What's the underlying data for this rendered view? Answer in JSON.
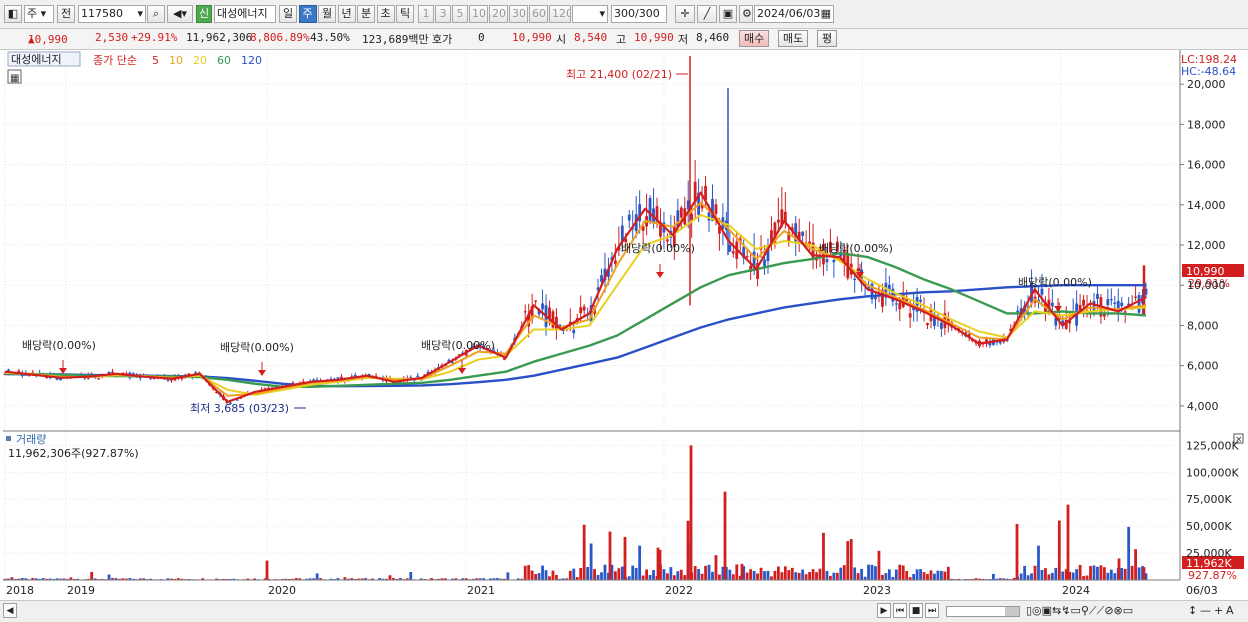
{
  "toolbar": {
    "period_type": "주",
    "prev_label": "전",
    "stock_code": "117580",
    "new_badge": "신",
    "stock_name": "대성에너지",
    "periods": [
      "일",
      "주",
      "월",
      "년",
      "분",
      "초",
      "틱"
    ],
    "selected_period": "주",
    "intervals": [
      "1",
      "3",
      "5",
      "10",
      "20",
      "30",
      "60",
      "120"
    ],
    "count_value": "300",
    "count_total": "/300",
    "date_value": "2024/06/03"
  },
  "quote": {
    "price": "10,990",
    "change": "2,530",
    "change_pct": "+29.91%",
    "volume": "11,962,306",
    "volume_pct": "8,806.89%",
    "turnover": "43.50%",
    "amount": "123,689백만",
    "hoga_label": "호가",
    "hoga_value": "0",
    "hoga_price": "10,990",
    "open_label": "시",
    "open": "8,540",
    "high_label": "고",
    "high": "10,990",
    "low_label": "저",
    "low": "8,460",
    "buy_label": "매수",
    "sell_label": "매도",
    "eval_label": "평"
  },
  "price_panel": {
    "stock_tag": "대성에너지",
    "ma_title": "종가 단순",
    "ma_labels": [
      {
        "label": "5",
        "color": "#d21e1e"
      },
      {
        "label": "10",
        "color": "#f0a020"
      },
      {
        "label": "20",
        "color": "#e8d020"
      },
      {
        "label": "60",
        "color": "#3a9a50"
      },
      {
        "label": "120",
        "color": "#2a50c8"
      }
    ],
    "lc_label": "LC:198.24",
    "hc_label": "HC:-48.64",
    "current_price_badge": "10,990",
    "current_pct_badge": "29.91%",
    "high_note": "최고 21,400 (02/21)",
    "low_note": "최저 3,685 (03/23)",
    "dividend_note": "배당락(0.00%)",
    "y_ticks": [
      "20,000",
      "18,000",
      "16,000",
      "14,000",
      "12,000",
      "10,000",
      "8,000",
      "6,000",
      "4,000"
    ]
  },
  "volume_panel": {
    "title": "거래량",
    "summary": "11,962,306주(927.87%)",
    "y_ticks": [
      "125,000K",
      "100,000K",
      "75,000K",
      "50,000K",
      "25,000K"
    ],
    "current_badge": "11,962K",
    "pct_badge": "927.87%"
  },
  "x_axis": {
    "year_labels": [
      "2018",
      "2019",
      "2020",
      "2021",
      "2022",
      "2023",
      "2024"
    ],
    "end_label": "06/03"
  },
  "colors": {
    "up": "#d21e1e",
    "down": "#2a58c8",
    "ma5": "#d21e1e",
    "ma10": "#f0a020",
    "ma20": "#e8d020",
    "ma60": "#3a9a50",
    "ma120": "#2a50c8"
  },
  "chart_data": {
    "type": "candlestick",
    "x_range": [
      "2018",
      "2024/06/03"
    ],
    "ylim": [
      3000,
      21400
    ],
    "high": {
      "value": 21400,
      "date": "02/21"
    },
    "low": {
      "value": 3685,
      "date": "03/23"
    },
    "last_close": 10990,
    "series": [
      {
        "name": "5",
        "values": [
          5700,
          5550,
          5400,
          5450,
          5600,
          5450,
          5350,
          5600,
          4200,
          4700,
          4950,
          5200,
          5300,
          5500,
          5200,
          5400,
          6200,
          7000,
          6400,
          9000,
          7800,
          8600,
          11800,
          13800,
          12500,
          14600,
          12200,
          10800,
          13200,
          11500,
          11400,
          9800,
          9300,
          8700,
          8000,
          7100,
          7300,
          9800,
          8000,
          9100,
          8700,
          9400
        ]
      },
      {
        "name": "10",
        "values": [
          5700,
          5560,
          5420,
          5440,
          5560,
          5470,
          5380,
          5550,
          4500,
          4600,
          4900,
          5150,
          5270,
          5450,
          5300,
          5350,
          6000,
          6700,
          6600,
          8500,
          7900,
          8300,
          11000,
          13200,
          12900,
          14100,
          12800,
          11300,
          12700,
          11800,
          11300,
          10000,
          9400,
          8800,
          8100,
          7400,
          7300,
          9300,
          8300,
          8900,
          8800,
          9000
        ]
      },
      {
        "name": "20",
        "values": [
          5650,
          5580,
          5450,
          5430,
          5520,
          5480,
          5400,
          5500,
          4800,
          4550,
          4800,
          5050,
          5200,
          5400,
          5350,
          5320,
          5700,
          6300,
          6500,
          7800,
          7800,
          8000,
          10000,
          12000,
          12500,
          13500,
          13000,
          11800,
          12200,
          12000,
          11200,
          10300,
          9600,
          9000,
          8300,
          7700,
          7400,
          8700,
          8500,
          8700,
          8800,
          8900
        ]
      },
      {
        "name": "60",
        "values": [
          5600,
          5580,
          5540,
          5500,
          5480,
          5470,
          5460,
          5430,
          5300,
          5100,
          4950,
          4950,
          5000,
          5050,
          5100,
          5150,
          5300,
          5500,
          5700,
          6200,
          6600,
          7000,
          7500,
          8300,
          9100,
          9900,
          10500,
          10800,
          11100,
          11300,
          11600,
          11400,
          10900,
          10300,
          9800,
          9200,
          8600,
          8600,
          8700,
          8600,
          8600,
          8500
        ]
      },
      {
        "name": "120",
        "values": [
          5580,
          5570,
          5560,
          5540,
          5520,
          5500,
          5480,
          5460,
          5380,
          5250,
          5100,
          5000,
          4980,
          4990,
          5000,
          5020,
          5080,
          5180,
          5300,
          5500,
          5800,
          6100,
          6400,
          6900,
          7400,
          7900,
          8300,
          8600,
          8900,
          9100,
          9300,
          9450,
          9550,
          9650,
          9700,
          9800,
          9900,
          9950,
          10000,
          10000,
          10000,
          10000
        ]
      }
    ],
    "volume_ylim": [
      0,
      130000
    ],
    "volume_units": "K"
  }
}
